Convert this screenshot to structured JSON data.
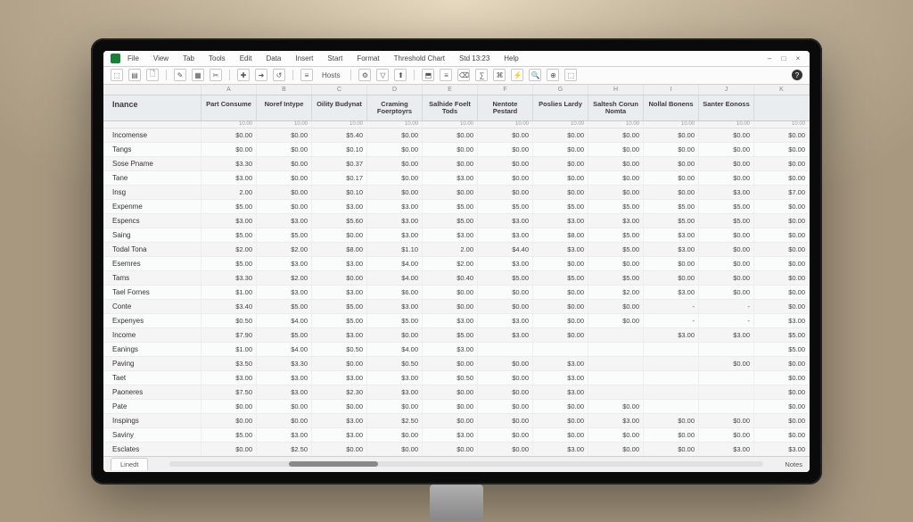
{
  "menu": {
    "items": [
      "File",
      "View",
      "Tab",
      "Tools",
      "Edit",
      "Data",
      "Insert",
      "Start",
      "Format",
      "Threshold Chart",
      "Std 13:23",
      "Help"
    ]
  },
  "window_controls": {
    "min": "–",
    "max": "□",
    "close": "×"
  },
  "toolbar": {
    "buttons": [
      "⬚",
      "▤",
      "🗋",
      "|",
      "✎",
      "▦",
      "✂",
      "|",
      "✚",
      "➜",
      "↺",
      "|",
      "≡",
      "Hosts",
      "|",
      "⚙",
      "▽",
      "⬆",
      "|",
      "⬒",
      "≡",
      "⌫",
      "∑",
      "⌘",
      "⚡",
      "🔍",
      "⊕",
      "⬚"
    ],
    "help": "?"
  },
  "col_letters": [
    "",
    "A",
    "B",
    "C",
    "D",
    "E",
    "F",
    "G",
    "H",
    "I",
    "J",
    "K"
  ],
  "headers": [
    "Inance",
    "Part Consume",
    "Noref Intype",
    "Oility Budynat",
    "Craming Foerptoyrs",
    "Salhide Foelt Tods",
    "Nentote Pestard",
    "Poslies Lardy",
    "Saltesh Corun Nomta",
    "Nollal Bonens",
    "Santer Eonoss"
  ],
  "sub": [
    "",
    "10.00",
    "10.00",
    "10.00",
    "10.00",
    "10.00",
    "10.00",
    "10.00",
    "10.00",
    "10.00",
    "10.00",
    "10.00"
  ],
  "rows": [
    {
      "label": "Incomense",
      "v": [
        "$0.00",
        "$0.00",
        "$5.40",
        "$0.00",
        "$0.00",
        "$0.00",
        "$0.00",
        "$0.00",
        "$0.00",
        "$0.00",
        "$0.00"
      ]
    },
    {
      "label": "Tangs",
      "v": [
        "$0.00",
        "$0.00",
        "$0.10",
        "$0.00",
        "$0.00",
        "$0.00",
        "$0.00",
        "$0.00",
        "$0.00",
        "$0.00",
        "$0.00"
      ]
    },
    {
      "label": "Sose Pname",
      "v": [
        "$3.30",
        "$0.00",
        "$0.37",
        "$0.00",
        "$0.00",
        "$0.00",
        "$0.00",
        "$0.00",
        "$0.00",
        "$0.00",
        "$0.00"
      ]
    },
    {
      "label": "Tane",
      "v": [
        "$3.00",
        "$0.00",
        "$0.17",
        "$0.00",
        "$3.00",
        "$0.00",
        "$0.00",
        "$0.00",
        "$0.00",
        "$0.00",
        "$0.00"
      ]
    },
    {
      "label": "Insg",
      "v": [
        "2.00",
        "$0.00",
        "$0.10",
        "$0.00",
        "$0.00",
        "$0.00",
        "$0.00",
        "$0.00",
        "$0.00",
        "$3.00",
        "$7.00"
      ]
    },
    {
      "label": "Expenme",
      "v": [
        "$5.00",
        "$0.00",
        "$3.00",
        "$3.00",
        "$5.00",
        "$5.00",
        "$5.00",
        "$5.00",
        "$5.00",
        "$5.00",
        "$0.00"
      ]
    },
    {
      "label": "Espencs",
      "v": [
        "$3.00",
        "$3.00",
        "$5.60",
        "$3.00",
        "$5.00",
        "$3.00",
        "$3.00",
        "$3.00",
        "$5.00",
        "$5.00",
        "$0.00"
      ]
    },
    {
      "label": "Saing",
      "v": [
        "$5.00",
        "$5.00",
        "$0.00",
        "$3.00",
        "$3.00",
        "$3.00",
        "$8.00",
        "$5.00",
        "$3.00",
        "$0.00",
        "$0.00"
      ]
    },
    {
      "label": "Todal Tona",
      "v": [
        "$2.00",
        "$2.00",
        "$8.00",
        "$1.10",
        "2.00",
        "$4.40",
        "$3.00",
        "$5.00",
        "$3.00",
        "$0.00",
        "$0.00"
      ]
    },
    {
      "label": "Esemres",
      "v": [
        "$5.00",
        "$3.00",
        "$3.00",
        "$4.00",
        "$2.00",
        "$3.00",
        "$0.00",
        "$0.00",
        "$0.00",
        "$0.00",
        "$0.00"
      ]
    },
    {
      "label": "Tams",
      "v": [
        "$3.30",
        "$2.00",
        "$0.00",
        "$4.00",
        "$0.40",
        "$5.00",
        "$5.00",
        "$5.00",
        "$0.00",
        "$0.00",
        "$0.00"
      ]
    },
    {
      "label": "Tael Fornes",
      "v": [
        "$1.00",
        "$3.00",
        "$3.00",
        "$6.00",
        "$0.00",
        "$0.00",
        "$0.00",
        "$2.00",
        "$3.00",
        "$0.00",
        "$0.00"
      ]
    },
    {
      "label": "Conte",
      "v": [
        "$3.40",
        "$5.00",
        "$5.00",
        "$3.00",
        "$0.00",
        "$0.00",
        "$0.00",
        "$0.00",
        "-",
        "-",
        "$0.00"
      ]
    },
    {
      "label": "Expenyes",
      "v": [
        "$0.50",
        "$4.00",
        "$5.00",
        "$5.00",
        "$3.00",
        "$3.00",
        "$0.00",
        "$0.00",
        "-",
        "-",
        "$3.00"
      ]
    },
    {
      "label": "Income",
      "v": [
        "$7.90",
        "$5.00",
        "$3.00",
        "$0.00",
        "$5.00",
        "$3.00",
        "$0.00",
        "",
        "$3.00",
        "$3.00",
        "$5.00"
      ]
    },
    {
      "label": "Eanings",
      "v": [
        "$1.00",
        "$4.00",
        "$0.50",
        "$4.00",
        "$3.00",
        "",
        "",
        "",
        "",
        "",
        "$5.00"
      ]
    },
    {
      "label": "Paving",
      "v": [
        "$3.50",
        "$3.30",
        "$0.00",
        "$0.50",
        "$0.00",
        "$0.00",
        "$3.00",
        "",
        "",
        "$0.00",
        "$0.00"
      ]
    },
    {
      "label": "Taet",
      "v": [
        "$3.00",
        "$3.00",
        "$3.00",
        "$3.00",
        "$0.50",
        "$0.00",
        "$3.00",
        "",
        "",
        "",
        "$0.00"
      ]
    },
    {
      "label": "Paoneres",
      "v": [
        "$7.50",
        "$3.00",
        "$2.30",
        "$3.00",
        "$0.00",
        "$0.00",
        "$3.00",
        "",
        "",
        "",
        "$0.00"
      ]
    },
    {
      "label": "Pate",
      "v": [
        "$0.00",
        "$0.00",
        "$0.00",
        "$0.00",
        "$0.00",
        "$0.00",
        "$0.00",
        "$0.00",
        "",
        "",
        "$0.00"
      ]
    },
    {
      "label": "Inspings",
      "v": [
        "$0.00",
        "$0.00",
        "$3.00",
        "$2.50",
        "$0.00",
        "$0.00",
        "$0.00",
        "$3.00",
        "$0.00",
        "$0.00",
        "$0.00"
      ]
    },
    {
      "label": "Saviny",
      "v": [
        "$5.00",
        "$3.00",
        "$3.00",
        "$0.00",
        "$3.00",
        "$0.00",
        "$0.00",
        "$0.00",
        "$0.00",
        "$0.00",
        "$0.00"
      ]
    },
    {
      "label": "Esclates",
      "v": [
        "$0.00",
        "$2.50",
        "$0.00",
        "$0.00",
        "$0.00",
        "$0.00",
        "$3.00",
        "$0.00",
        "$0.00",
        "$3.00",
        "$3.00"
      ]
    }
  ],
  "sheet": {
    "tab_label": "Linedt",
    "tab2": "Notes"
  }
}
